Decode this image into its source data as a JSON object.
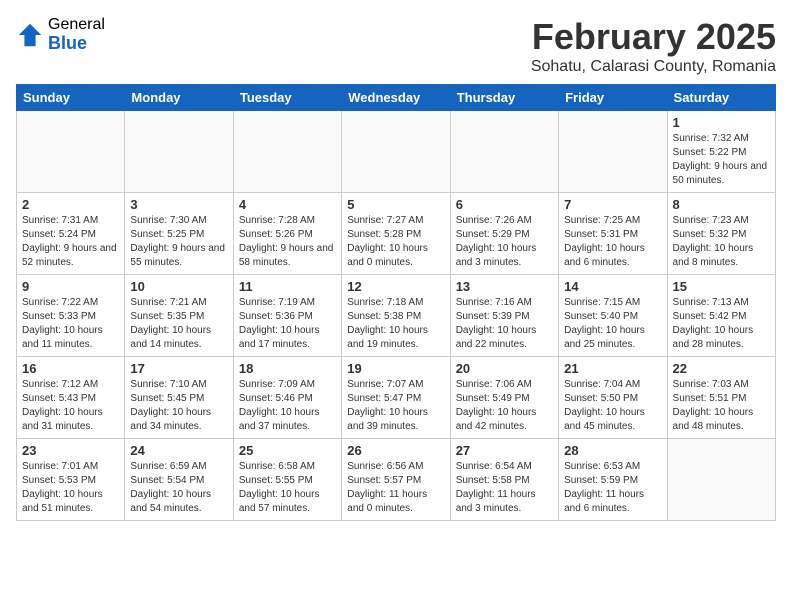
{
  "header": {
    "logo_general": "General",
    "logo_blue": "Blue",
    "month_title": "February 2025",
    "location": "Sohatu, Calarasi County, Romania"
  },
  "weekdays": [
    "Sunday",
    "Monday",
    "Tuesday",
    "Wednesday",
    "Thursday",
    "Friday",
    "Saturday"
  ],
  "weeks": [
    [
      {
        "day": "",
        "info": ""
      },
      {
        "day": "",
        "info": ""
      },
      {
        "day": "",
        "info": ""
      },
      {
        "day": "",
        "info": ""
      },
      {
        "day": "",
        "info": ""
      },
      {
        "day": "",
        "info": ""
      },
      {
        "day": "1",
        "info": "Sunrise: 7:32 AM\nSunset: 5:22 PM\nDaylight: 9 hours and 50 minutes."
      }
    ],
    [
      {
        "day": "2",
        "info": "Sunrise: 7:31 AM\nSunset: 5:24 PM\nDaylight: 9 hours and 52 minutes."
      },
      {
        "day": "3",
        "info": "Sunrise: 7:30 AM\nSunset: 5:25 PM\nDaylight: 9 hours and 55 minutes."
      },
      {
        "day": "4",
        "info": "Sunrise: 7:28 AM\nSunset: 5:26 PM\nDaylight: 9 hours and 58 minutes."
      },
      {
        "day": "5",
        "info": "Sunrise: 7:27 AM\nSunset: 5:28 PM\nDaylight: 10 hours and 0 minutes."
      },
      {
        "day": "6",
        "info": "Sunrise: 7:26 AM\nSunset: 5:29 PM\nDaylight: 10 hours and 3 minutes."
      },
      {
        "day": "7",
        "info": "Sunrise: 7:25 AM\nSunset: 5:31 PM\nDaylight: 10 hours and 6 minutes."
      },
      {
        "day": "8",
        "info": "Sunrise: 7:23 AM\nSunset: 5:32 PM\nDaylight: 10 hours and 8 minutes."
      }
    ],
    [
      {
        "day": "9",
        "info": "Sunrise: 7:22 AM\nSunset: 5:33 PM\nDaylight: 10 hours and 11 minutes."
      },
      {
        "day": "10",
        "info": "Sunrise: 7:21 AM\nSunset: 5:35 PM\nDaylight: 10 hours and 14 minutes."
      },
      {
        "day": "11",
        "info": "Sunrise: 7:19 AM\nSunset: 5:36 PM\nDaylight: 10 hours and 17 minutes."
      },
      {
        "day": "12",
        "info": "Sunrise: 7:18 AM\nSunset: 5:38 PM\nDaylight: 10 hours and 19 minutes."
      },
      {
        "day": "13",
        "info": "Sunrise: 7:16 AM\nSunset: 5:39 PM\nDaylight: 10 hours and 22 minutes."
      },
      {
        "day": "14",
        "info": "Sunrise: 7:15 AM\nSunset: 5:40 PM\nDaylight: 10 hours and 25 minutes."
      },
      {
        "day": "15",
        "info": "Sunrise: 7:13 AM\nSunset: 5:42 PM\nDaylight: 10 hours and 28 minutes."
      }
    ],
    [
      {
        "day": "16",
        "info": "Sunrise: 7:12 AM\nSunset: 5:43 PM\nDaylight: 10 hours and 31 minutes."
      },
      {
        "day": "17",
        "info": "Sunrise: 7:10 AM\nSunset: 5:45 PM\nDaylight: 10 hours and 34 minutes."
      },
      {
        "day": "18",
        "info": "Sunrise: 7:09 AM\nSunset: 5:46 PM\nDaylight: 10 hours and 37 minutes."
      },
      {
        "day": "19",
        "info": "Sunrise: 7:07 AM\nSunset: 5:47 PM\nDaylight: 10 hours and 39 minutes."
      },
      {
        "day": "20",
        "info": "Sunrise: 7:06 AM\nSunset: 5:49 PM\nDaylight: 10 hours and 42 minutes."
      },
      {
        "day": "21",
        "info": "Sunrise: 7:04 AM\nSunset: 5:50 PM\nDaylight: 10 hours and 45 minutes."
      },
      {
        "day": "22",
        "info": "Sunrise: 7:03 AM\nSunset: 5:51 PM\nDaylight: 10 hours and 48 minutes."
      }
    ],
    [
      {
        "day": "23",
        "info": "Sunrise: 7:01 AM\nSunset: 5:53 PM\nDaylight: 10 hours and 51 minutes."
      },
      {
        "day": "24",
        "info": "Sunrise: 6:59 AM\nSunset: 5:54 PM\nDaylight: 10 hours and 54 minutes."
      },
      {
        "day": "25",
        "info": "Sunrise: 6:58 AM\nSunset: 5:55 PM\nDaylight: 10 hours and 57 minutes."
      },
      {
        "day": "26",
        "info": "Sunrise: 6:56 AM\nSunset: 5:57 PM\nDaylight: 11 hours and 0 minutes."
      },
      {
        "day": "27",
        "info": "Sunrise: 6:54 AM\nSunset: 5:58 PM\nDaylight: 11 hours and 3 minutes."
      },
      {
        "day": "28",
        "info": "Sunrise: 6:53 AM\nSunset: 5:59 PM\nDaylight: 11 hours and 6 minutes."
      },
      {
        "day": "",
        "info": ""
      }
    ]
  ]
}
